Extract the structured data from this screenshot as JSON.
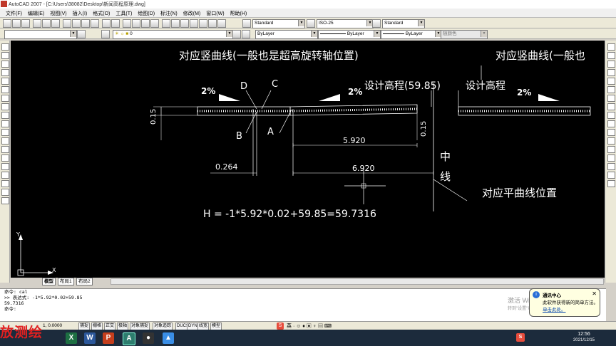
{
  "window": {
    "title": "AutoCAD 2007 - [C:\\Users\\38082\\Desktop\\新闻高程原理.dwg]"
  },
  "menu": [
    "文件(F)",
    "编辑(E)",
    "视图(V)",
    "插入(I)",
    "格式(O)",
    "工具(T)",
    "绘图(D)",
    "标注(N)",
    "修改(M)",
    "窗口(W)",
    "帮助(H)"
  ],
  "toolbar": {
    "text_style": "Standard",
    "dim_style": "ISO-25",
    "table_style": "Standard",
    "layer": "0",
    "color": "ByLayer",
    "linetype": "ByLayer",
    "lineweight": "ByLayer",
    "plot_style": "随颜色"
  },
  "drawing": {
    "title_left": "对应竖曲线(一般也是超高旋转轴位置)",
    "title_right": "对应竖曲线(一般也",
    "grade_left": "2%",
    "grade_mid": "2%",
    "grade_right": "2%",
    "label_D": "D",
    "label_C": "C",
    "label_B": "B",
    "label_A": "A",
    "design_elev_value": "设计高程(59.85)",
    "design_elev": "设计高程",
    "dim_left_vert": "0.15",
    "dim_right_vert": "0.15",
    "dim_5920": "5.920",
    "dim_6920": "6.920",
    "dim_0264": "0.264",
    "centerline_1": "中",
    "centerline_2": "线",
    "plan_curve": "对应平曲线位置",
    "formula": "H = -1*5.92*0.02+59.85=59.7316",
    "ucs_x": "X",
    "ucs_y": "Y"
  },
  "tabs": [
    "模型",
    "布局1",
    "布局2"
  ],
  "command": {
    "lines": [
      "命令: cal",
      ">> 表达式: -1*5.92*0.02+59.85",
      "59.7316",
      "命令:"
    ]
  },
  "status": {
    "coords": "1, 0.0000",
    "buttons": [
      "捕捉",
      "栅格",
      "正交",
      "极轴",
      "对象捕捉",
      "对象追踪",
      "DUCS",
      "DYN",
      "线宽",
      "模型"
    ]
  },
  "bubble": {
    "title": "通讯中心",
    "body": "此软件获得新的简单方法。",
    "link": "单击此处。"
  },
  "watermark": "激活 Windows",
  "watermark_sub": "转到\"设置\"以激活 Windows。",
  "brand": "放测绘",
  "taskbar": {
    "time": "12:56",
    "date": "2021/12/15"
  }
}
